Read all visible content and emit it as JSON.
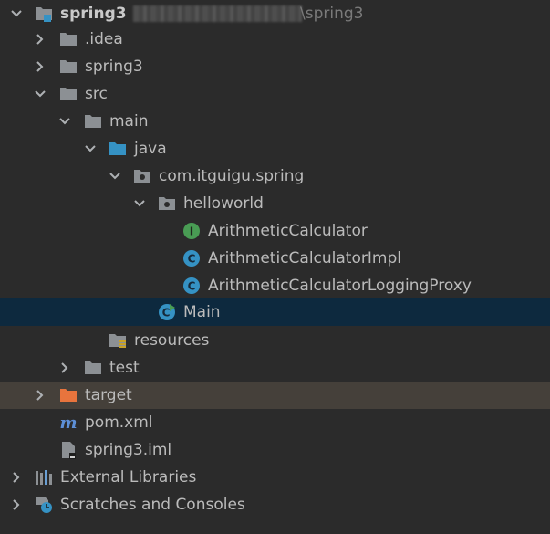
{
  "project": {
    "name": "spring3",
    "path_suffix": "\\spring3"
  },
  "tree": {
    "idea": ".idea",
    "spring3_dir": "spring3",
    "src": "src",
    "main": "main",
    "java": "java",
    "package": "com.itguigu.spring",
    "helloworld": "helloworld",
    "arith_calc": "ArithmeticCalculator",
    "arith_calc_impl": "ArithmeticCalculatorImpl",
    "arith_calc_proxy": "ArithmeticCalculatorLoggingProxy",
    "main_class": "Main",
    "resources": "resources",
    "test": "test",
    "target": "target",
    "pom": "pom.xml",
    "iml": "spring3.iml",
    "external_libraries": "External Libraries",
    "scratches": "Scratches and Consoles"
  },
  "colors": {
    "background": "#2b2b2b",
    "selection": "#0d293e",
    "excluded": "#45403a",
    "folder": "#8c9094",
    "source_folder": "#3592c4",
    "excluded_folder": "#e8743d",
    "interface_icon": "#499c54",
    "class_icon": "#3592c4"
  }
}
